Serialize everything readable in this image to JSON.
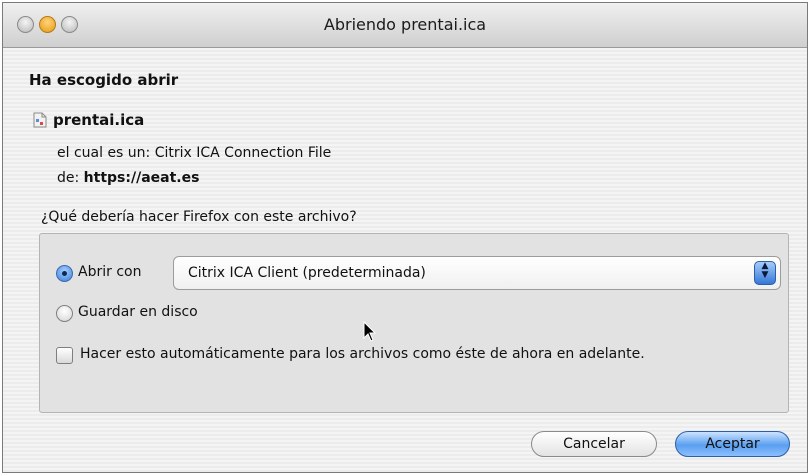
{
  "window": {
    "title": "Abriendo prentai.ica"
  },
  "dialog": {
    "heading": "Ha escogido abrir",
    "file_name": "prentai.ica",
    "type_prefix": "el cual es un:",
    "type_value": "Citrix ICA Connection File",
    "from_prefix": "de:",
    "from_value": "https://aeat.es",
    "question": "¿Qué debería hacer Firefox con este archivo?"
  },
  "options": {
    "open_with_label": "Abrir con",
    "open_with_selected": true,
    "open_with_app": "Citrix ICA Client (predeterminada)",
    "save_label": "Guardar en disco",
    "save_selected": false,
    "auto_label": "Hacer esto automáticamente para los archivos como éste de ahora en adelante.",
    "auto_checked": false
  },
  "buttons": {
    "cancel": "Cancelar",
    "accept": "Aceptar"
  },
  "colors": {
    "accent": "#3b7fdb"
  }
}
